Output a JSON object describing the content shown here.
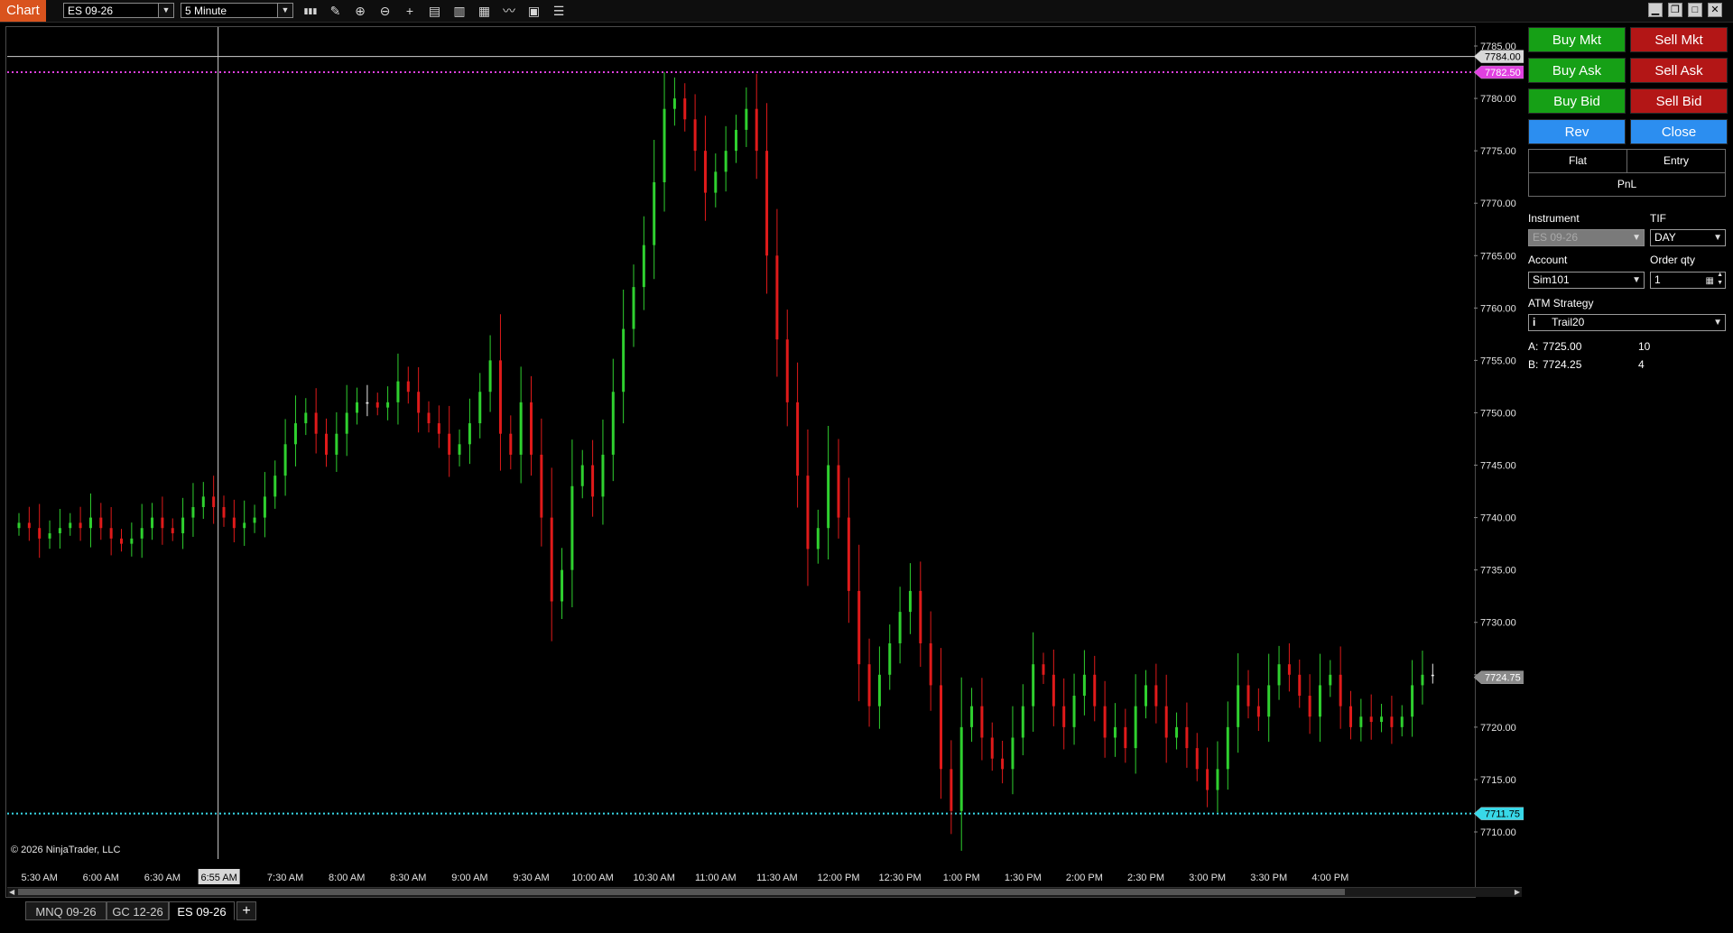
{
  "app": {
    "title": "Chart"
  },
  "toolbar": {
    "instrument": "ES 09-26",
    "interval": "5 Minute",
    "tools": [
      "bar-chart-icon",
      "draw-pencil-icon",
      "zoom-in-icon",
      "zoom-out-icon",
      "crosshair-icon",
      "properties-icon",
      "data-box-icon",
      "indicators-icon",
      "strategies-icon",
      "chart-template-icon",
      "list-icon"
    ],
    "window_buttons": [
      "minimize-icon",
      "restore-icon",
      "maximize-icon",
      "close-icon"
    ]
  },
  "chart": {
    "copyright": "© 2026 NinjaTrader, LLC",
    "y_ticks": [
      "7785.00",
      "7780.00",
      "7775.00",
      "7770.00",
      "7765.00",
      "7760.00",
      "7755.00",
      "7750.00",
      "7745.00",
      "7740.00",
      "7735.00",
      "7730.00",
      "7725.00",
      "7720.00",
      "7715.00",
      "7710.00"
    ],
    "y_tick_values": [
      7785,
      7780,
      7775,
      7770,
      7765,
      7760,
      7755,
      7750,
      7745,
      7740,
      7735,
      7730,
      7725,
      7720,
      7715,
      7710
    ],
    "x_ticks": [
      "5:30 AM",
      "6:00 AM",
      "6:30 AM",
      "6:55 AM",
      "7:30 AM",
      "8:00 AM",
      "8:30 AM",
      "9:00 AM",
      "9:30 AM",
      "10:00 AM",
      "10:30 AM",
      "11:00 AM",
      "11:30 AM",
      "12:00 PM",
      "12:30 PM",
      "1:00 PM",
      "1:30 PM",
      "2:00 PM",
      "2:30 PM",
      "3:00 PM",
      "3:30 PM",
      "4:00 PM"
    ],
    "crosshair": {
      "time_label": "6:55 AM",
      "price_label": "7784.00",
      "price": 7784.0
    },
    "price_labels": [
      {
        "text": "7782.50",
        "price": 7782.5,
        "color": "#e040e0",
        "name": "magenta-line-label"
      },
      {
        "text": "7724.75",
        "price": 7724.75,
        "color": "#8a8a8a",
        "name": "last-price-label"
      },
      {
        "text": "7711.75",
        "price": 7711.75,
        "color": "#38d8e8",
        "name": "cyan-line-label"
      }
    ],
    "horizontal_lines": [
      {
        "price": 7782.5,
        "color": "#e040e0"
      },
      {
        "price": 7711.75,
        "color": "#38d8e8"
      }
    ],
    "up_color": "#2fd02f",
    "down_color": "#e01a1a",
    "doji_color": "#e8e8e8"
  },
  "chart_data": {
    "type": "candlestick",
    "x_start": "5:20 AM",
    "interval_minutes": 5,
    "ylim": [
      7708,
      7787
    ],
    "closes": [
      7739.5,
      7739,
      7738,
      7738.5,
      7739,
      7739.5,
      7739,
      7740,
      7739,
      7738,
      7737.5,
      7738,
      7739,
      7740,
      7739,
      7738.5,
      7740,
      7741,
      7742,
      7741,
      7740,
      7739,
      7739.5,
      7740,
      7742,
      7744,
      7747,
      7749,
      7750,
      7748,
      7746,
      7748,
      7750,
      7751,
      7751,
      7750.5,
      7751,
      7753,
      7752,
      7750,
      7749,
      7748,
      7746,
      7747,
      7749,
      7752,
      7755,
      7748,
      7746,
      7751,
      7746,
      7740,
      7732,
      7735,
      7743,
      7745,
      7742,
      7746,
      7752,
      7758,
      7762,
      7766,
      7772,
      7779,
      7780,
      7778,
      7775,
      7771,
      7773,
      7775,
      7777,
      7779,
      7775,
      7765,
      7757,
      7751,
      7744,
      7737,
      7739,
      7745,
      7740,
      7733,
      7726,
      7722,
      7725,
      7728,
      7731,
      7733,
      7728,
      7724,
      7716,
      7712,
      7720,
      7722,
      7719,
      7717,
      7716,
      7719,
      7722,
      7726,
      7725,
      7722,
      7720,
      7723,
      7725,
      7722,
      7719,
      7720,
      7718,
      7722,
      7724,
      7722,
      7719,
      7720,
      7718,
      7716,
      7714,
      7716,
      7720,
      7724,
      7722,
      7721,
      7724,
      7726,
      7725,
      7723,
      7721,
      7724,
      7725,
      7722,
      7720,
      7721,
      7720.5,
      7721,
      7720,
      7721,
      7724,
      7725,
      7725
    ],
    "note": "approximate closes estimated from gridlines"
  },
  "panel": {
    "buttons": [
      {
        "label": "Buy Mkt",
        "color": "green",
        "name": "buy-market-button"
      },
      {
        "label": "Sell Mkt",
        "color": "red",
        "name": "sell-market-button"
      },
      {
        "label": "Buy Ask",
        "color": "green",
        "name": "buy-ask-button"
      },
      {
        "label": "Sell Ask",
        "color": "red",
        "name": "sell-ask-button"
      },
      {
        "label": "Buy Bid",
        "color": "green",
        "name": "buy-bid-button"
      },
      {
        "label": "Sell Bid",
        "color": "red",
        "name": "sell-bid-button"
      },
      {
        "label": "Rev",
        "color": "blue",
        "name": "reverse-button"
      },
      {
        "label": "Close",
        "color": "blue",
        "name": "close-position-button"
      }
    ],
    "position_grid": {
      "flat": "Flat",
      "entry": "Entry",
      "pnl": "PnL"
    },
    "instrument_label": "Instrument",
    "instrument_value": "ES 09-26",
    "tif_label": "TIF",
    "tif_value": "DAY",
    "account_label": "Account",
    "account_value": "Sim101",
    "qty_label": "Order qty",
    "qty_value": "1",
    "atm_label": "ATM Strategy",
    "atm_value": "Trail20",
    "ask_label": "A:",
    "ask_price": "7725.00",
    "ask_size": "10",
    "bid_label": "B:",
    "bid_price": "7724.25",
    "bid_size": "4"
  },
  "tabs": [
    {
      "label": "MNQ 09-26",
      "active": false
    },
    {
      "label": "GC 12-26",
      "active": false
    },
    {
      "label": "ES 09-26",
      "active": true
    }
  ]
}
